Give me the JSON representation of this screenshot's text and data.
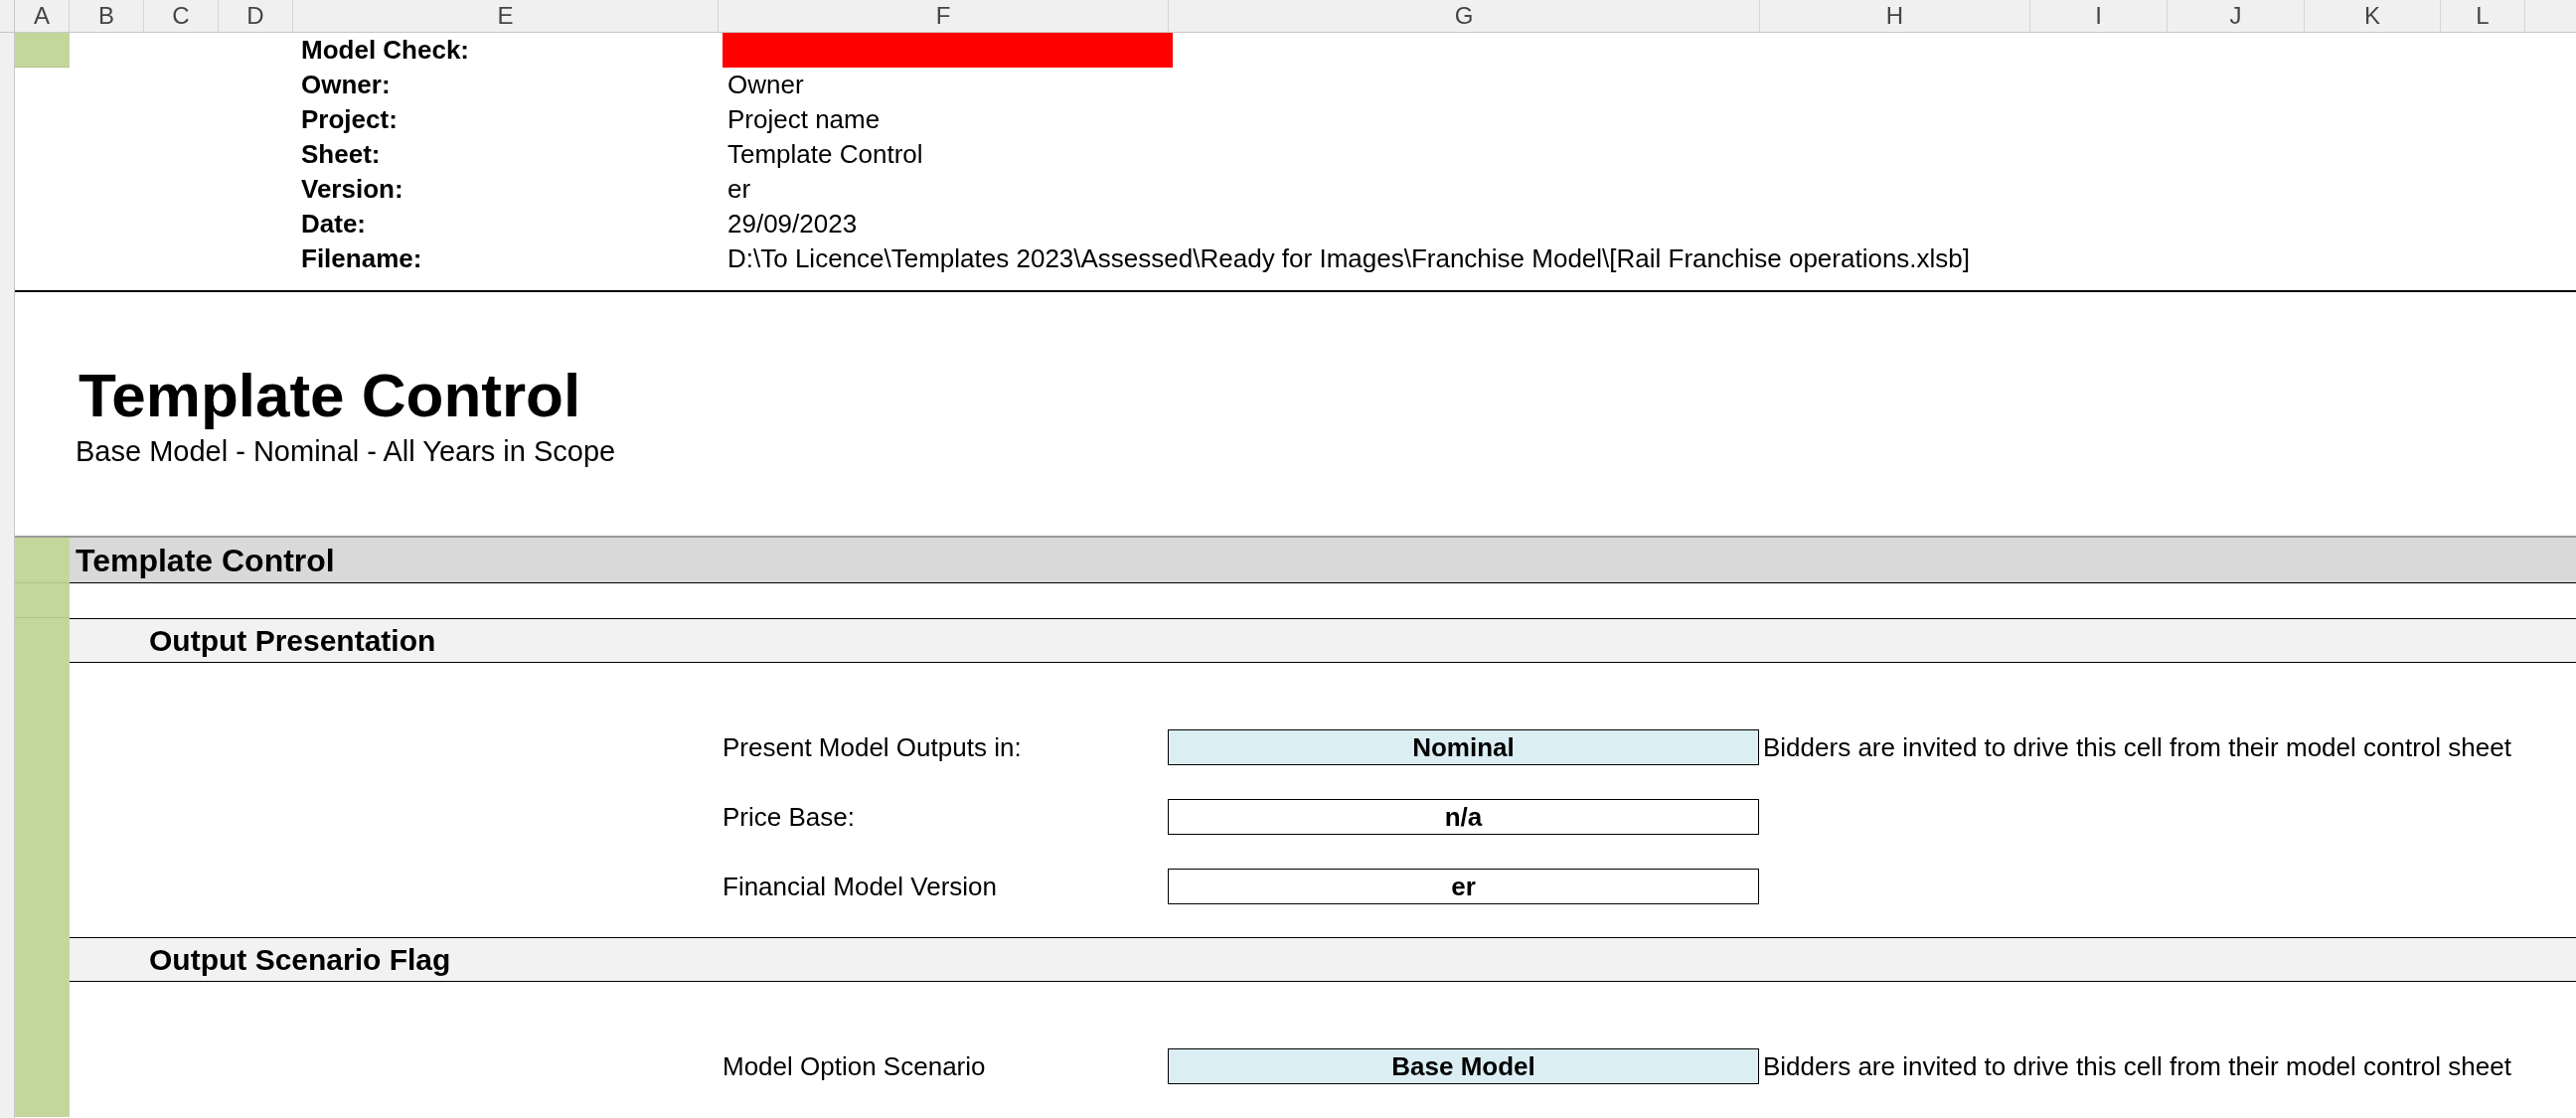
{
  "column_headers": [
    "A",
    "B",
    "C",
    "D",
    "E",
    "F",
    "G",
    "H",
    "I",
    "J",
    "K",
    "L"
  ],
  "header_info": [
    {
      "label": "Model Check:",
      "kind": "status",
      "color": "#ff0000"
    },
    {
      "label": "Owner:",
      "kind": "text",
      "value": "Owner"
    },
    {
      "label": "Project:",
      "kind": "text",
      "value": "Project name"
    },
    {
      "label": "Sheet:",
      "kind": "text",
      "value": "Template Control"
    },
    {
      "label": "Version:",
      "kind": "text",
      "value": "er"
    },
    {
      "label": "Date:",
      "kind": "text",
      "value": "29/09/2023"
    },
    {
      "label": "Filename:",
      "kind": "text",
      "value": "D:\\To Licence\\Templates 2023\\Assessed\\Ready for Images\\Franchise Model\\[Rail Franchise operations.xlsb]"
    }
  ],
  "title": "Template Control",
  "subtitle": "Base Model - Nominal - All Years in Scope",
  "section": {
    "title": "Template Control",
    "subsections": [
      {
        "title": "Output Presentation",
        "fields": [
          {
            "label": "Present Model Outputs in:",
            "kind": "input",
            "value": "Nominal",
            "note": "Bidders are invited to drive this cell from their model control sheet"
          },
          {
            "label": "Price Base:",
            "kind": "calc",
            "value": "n/a"
          },
          {
            "label": "Financial Model Version",
            "kind": "calc",
            "value": "er"
          }
        ]
      },
      {
        "title": "Output Scenario Flag",
        "fields": [
          {
            "label": "Model Option Scenario",
            "kind": "input",
            "value": "Base Model",
            "note": "Bidders are invited to drive this cell from their model control sheet"
          }
        ]
      }
    ]
  }
}
